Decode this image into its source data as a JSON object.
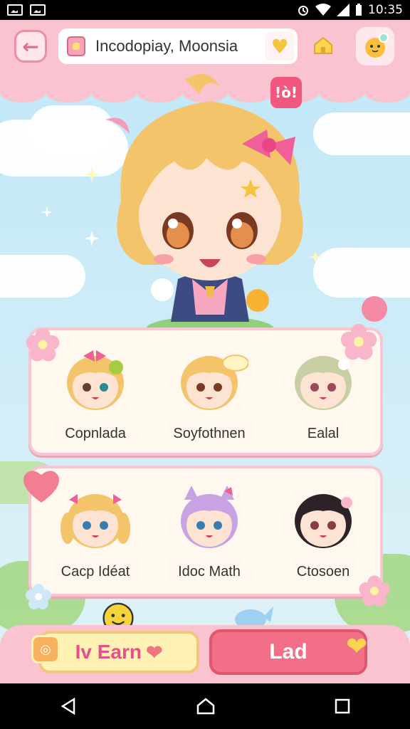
{
  "status_bar": {
    "time": "10:35"
  },
  "header": {
    "back_icon": "arrow-left-icon",
    "title": "Incodopiay, Moonsia",
    "heart_icon": "heart-icon",
    "home_icon": "home-icon",
    "profile_icon": "pet-avatar-icon"
  },
  "hero": {
    "badge_text": "!ò!"
  },
  "characters": [
    {
      "name": "Copnlada"
    },
    {
      "name": "Soyfothnen"
    },
    {
      "name": "Ealal"
    },
    {
      "name": "Cacp Idéat"
    },
    {
      "name": "Idoc Math"
    },
    {
      "name": "Ctosoen"
    }
  ],
  "actions": {
    "left_label": "Iv Earn",
    "right_label": "Lad"
  },
  "colors": {
    "header_pink": "#f9c3cf",
    "card_bg": "#fff8ee",
    "accent_red": "#f17088",
    "sky": "#bfe6f7"
  }
}
